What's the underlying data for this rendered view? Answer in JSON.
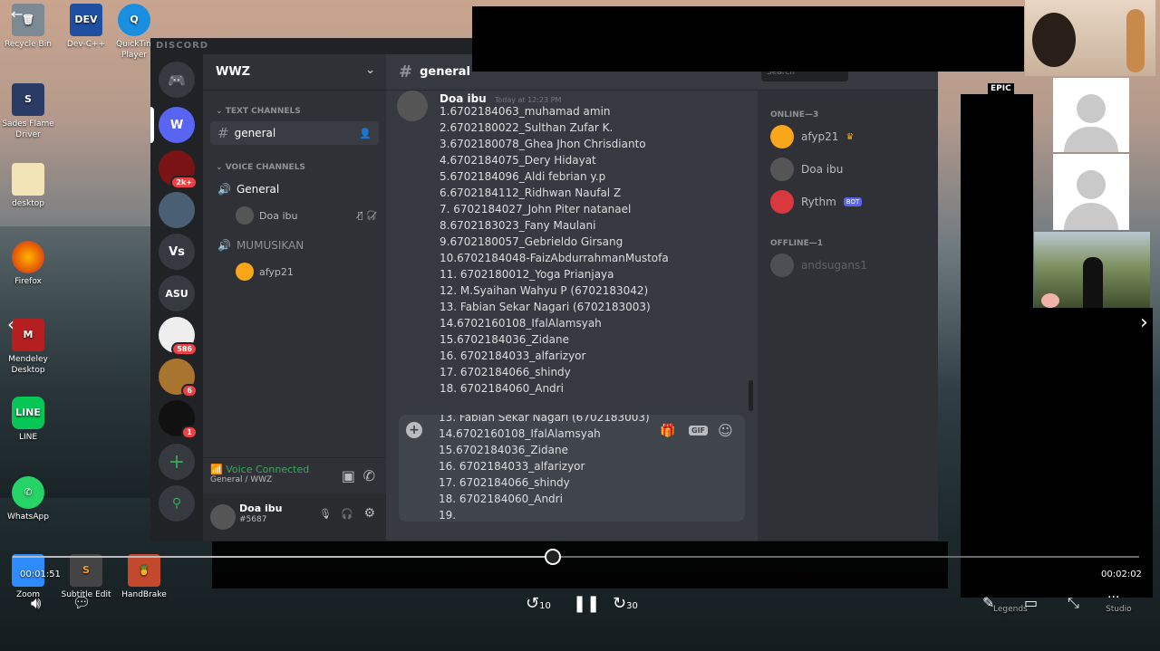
{
  "desktop": {
    "icons": [
      {
        "label": "Recycle Bin",
        "name": "recycle-bin"
      },
      {
        "label": "Dev-C++",
        "name": "dev-cpp"
      },
      {
        "label": "QuickTime Player",
        "name": "quicktime"
      },
      {
        "label": "Sades Flame Driver",
        "name": "sades"
      },
      {
        "label": "desktop",
        "name": "desktop-folder"
      },
      {
        "label": "Firefox",
        "name": "firefox"
      },
      {
        "label": "Mendeley Desktop",
        "name": "mendeley"
      },
      {
        "label": "LINE",
        "name": "line"
      },
      {
        "label": "WhatsApp",
        "name": "whatsapp"
      },
      {
        "label": "Zoom",
        "name": "zoom"
      },
      {
        "label": "Subtitle Edit",
        "name": "subtitle-edit"
      },
      {
        "label": "HandBrake",
        "name": "handbrake"
      }
    ]
  },
  "discord": {
    "brand": "DISCORD",
    "servers": [
      {
        "label": "W",
        "badge": ""
      },
      {
        "label": "",
        "badge": "2k+"
      },
      {
        "label": "",
        "badge": ""
      },
      {
        "label": "Vs",
        "badge": ""
      },
      {
        "label": "ASU",
        "badge": ""
      },
      {
        "label": "",
        "badge": "586"
      },
      {
        "label": "",
        "badge": "6"
      },
      {
        "label": "",
        "badge": "1"
      }
    ],
    "guild_name": "WWZ",
    "text_channels_label": "TEXT CHANNELS",
    "voice_channels_label": "VOICE CHANNELS",
    "text_channel": "general",
    "voice_channel_1": "General",
    "voice_channel_1_user": "Doa ibu",
    "voice_channel_2": "MUMUSIKAN",
    "voice_channel_2_user": "afyp21",
    "voice_status": "Voice Connected",
    "voice_location": "General / WWZ",
    "user_name": "Doa ibu",
    "user_tag": "#5687",
    "channel_header": "general",
    "search_placeholder": "Search",
    "message": {
      "author": "Doa ibu",
      "timestamp": "Today at 12:23 PM",
      "lines": [
        "1.6702184063_muhamad amin",
        "2.6702180022_Sulthan Zufar K.",
        "3.6702180078_Ghea Jhon Chrisdianto",
        "4.6702184075_Dery Hidayat",
        "5.6702184096_Aldi febrian y.p",
        "6.6702184112_Ridhwan Naufal Z",
        "7. 6702184027_John Piter natanael",
        "8.6702183023_Fany Maulani",
        "9.6702180057_Gebrieldo Girsang",
        "10.6702184048-FaizAbdurrahmanMustofa",
        "11. 6702180012_Yoga Prianjaya",
        "12. M.Syaihan Wahyu P (6702183042)",
        "13. Fabian Sekar Nagari (6702183003)",
        "14.6702160108_IfalAlamsyah",
        "15.6702184036_Zidane",
        "16. 6702184033_alfarizyor",
        "17. 6702184066_shindy",
        "18. 6702184060_Andri"
      ]
    },
    "composer_lines": [
      "13. Fabian Sekar Nagari (6702183003)",
      "14.6702160108_IfalAlamsyah",
      "15.6702184036_Zidane",
      "16. 6702184033_alfarizyor",
      "17. 6702184066_shindy",
      "18. 6702184060_Andri",
      "19."
    ],
    "gif_label": "GIF",
    "online_label": "ONLINE—3",
    "offline_label": "OFFLINE—1",
    "members_online": [
      {
        "name": "afyp21",
        "extra": "♛"
      },
      {
        "name": "Doa ibu",
        "extra": ""
      },
      {
        "name": "Rythm",
        "extra": "BOT"
      }
    ],
    "members_offline": [
      {
        "name": "andsugans1"
      }
    ]
  },
  "player": {
    "elapsed": "00:01:51",
    "remaining": "00:02:02",
    "progress": 0.478,
    "skip_back": "10",
    "skip_forward": "30",
    "legends_label": "Legends",
    "studio_label": "Studio",
    "epic_label": "EPIC"
  },
  "colors": {
    "discord_bg": "#36393f",
    "sidebar_bg": "#2f3136",
    "server_bg": "#202225",
    "blurple": "#5865f2",
    "online_green": "#3ba55d",
    "badge_red": "#ed4245"
  }
}
